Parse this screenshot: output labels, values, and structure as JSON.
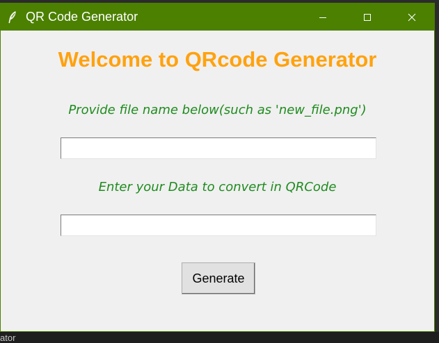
{
  "window": {
    "title": "QR Code Generator",
    "icon": "feather-icon",
    "titlebar_color": "#4b8000",
    "controls": [
      "minimize-icon",
      "maximize-icon",
      "close-icon"
    ]
  },
  "main": {
    "heading": "Welcome to QRcode Generator",
    "heading_color": "#ffa20f",
    "label_color": "#1f8b1f",
    "filename_label": "Provide file name below(such as 'new_file.png')",
    "filename_value": "",
    "data_label": "Enter your Data to convert in QRCode",
    "data_value": "",
    "generate_label": "Generate"
  },
  "background": {
    "bottom_text": "ator"
  }
}
